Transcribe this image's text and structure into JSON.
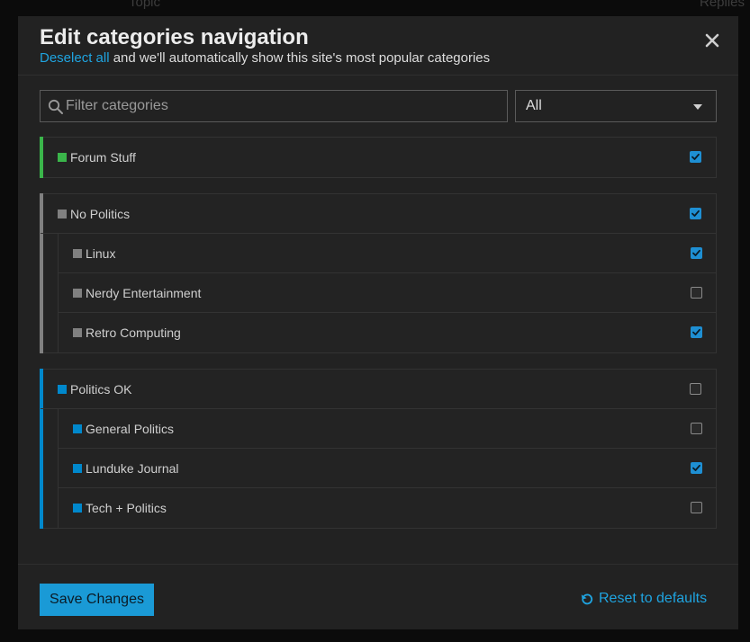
{
  "background": {
    "topic_header": "Topic",
    "replies_header": "Replies"
  },
  "modal": {
    "title": "Edit categories navigation",
    "subtitle_link": "Deselect all",
    "subtitle_rest": " and we'll automatically show this site's most popular categories",
    "close_icon": "close-icon"
  },
  "filter": {
    "placeholder": "Filter categories",
    "value": "",
    "icon": "search-icon"
  },
  "select": {
    "value": "All",
    "icon": "caret-down-icon"
  },
  "colors": {
    "accent": "#1fa4e0",
    "checkbox_checked": "#1e8fd3",
    "green": "#3ab54a",
    "gray": "#808080",
    "blue": "#0088cc"
  },
  "groups": [
    {
      "color": "#3ab54a",
      "parent": {
        "label": "Forum Stuff",
        "checked": true
      },
      "children": []
    },
    {
      "color": "#808080",
      "parent": {
        "label": "No Politics",
        "checked": true
      },
      "children": [
        {
          "label": "Linux",
          "checked": true
        },
        {
          "label": "Nerdy Entertainment",
          "checked": false
        },
        {
          "label": "Retro Computing",
          "checked": true
        }
      ]
    },
    {
      "color": "#0088cc",
      "parent": {
        "label": "Politics OK",
        "checked": false
      },
      "children": [
        {
          "label": "General Politics",
          "checked": false
        },
        {
          "label": "Lunduke Journal",
          "checked": true
        },
        {
          "label": "Tech + Politics",
          "checked": false
        }
      ]
    }
  ],
  "footer": {
    "save_label": "Save Changes",
    "reset_label": "Reset to defaults",
    "reset_icon": "undo-icon"
  }
}
